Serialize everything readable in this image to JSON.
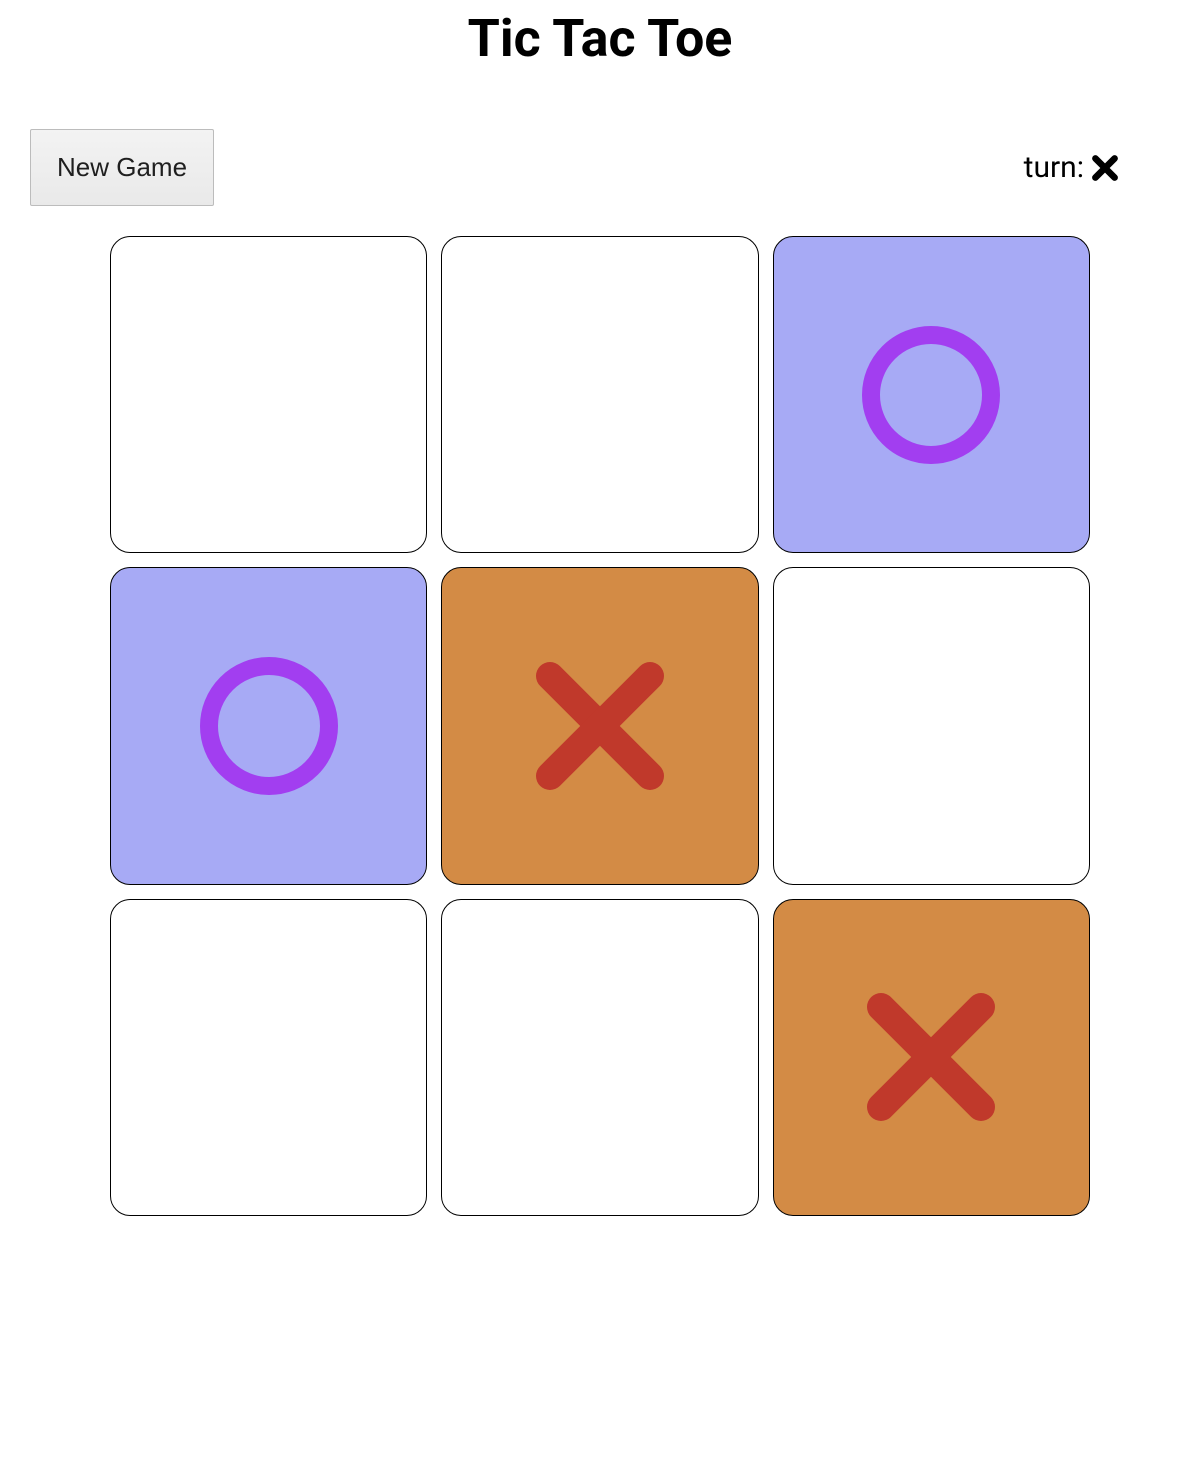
{
  "title": "Tic Tac Toe",
  "controls": {
    "new_game_label": "New Game",
    "turn_label": "turn:",
    "current_turn": "X"
  },
  "board": {
    "cells": [
      {
        "row": 0,
        "col": 0,
        "mark": ""
      },
      {
        "row": 0,
        "col": 1,
        "mark": ""
      },
      {
        "row": 0,
        "col": 2,
        "mark": "O"
      },
      {
        "row": 1,
        "col": 0,
        "mark": "O"
      },
      {
        "row": 1,
        "col": 1,
        "mark": "X"
      },
      {
        "row": 1,
        "col": 2,
        "mark": ""
      },
      {
        "row": 2,
        "col": 0,
        "mark": ""
      },
      {
        "row": 2,
        "col": 1,
        "mark": ""
      },
      {
        "row": 2,
        "col": 2,
        "mark": "X"
      }
    ]
  },
  "colors": {
    "cell_o_bg": "#a7aaf5",
    "cell_x_bg": "#d38b45",
    "o_stroke": "#a23ef0",
    "x_stroke": "#c0392b"
  }
}
